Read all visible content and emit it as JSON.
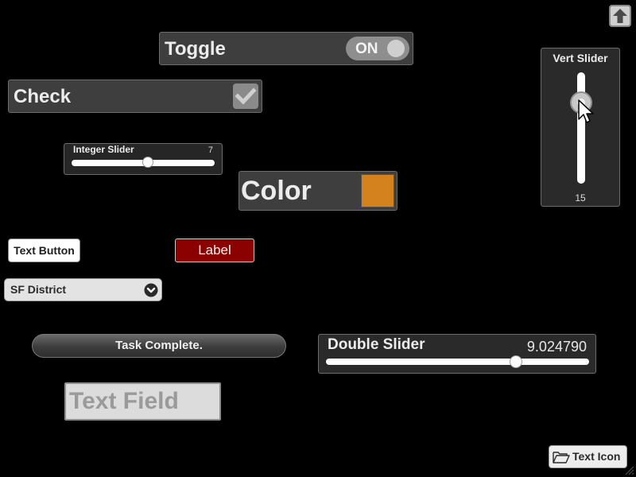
{
  "toggle": {
    "label": "Toggle",
    "state": "ON",
    "on": true
  },
  "check": {
    "label": "Check",
    "checked": true
  },
  "integer_slider": {
    "label": "Integer Slider",
    "value": "7",
    "fraction": 0.54
  },
  "color_picker": {
    "label": "Color",
    "color": "#d4821e"
  },
  "vert_slider": {
    "label": "Vert Slider",
    "value": "15",
    "fraction": 0.75
  },
  "text_button": {
    "label": "Text Button"
  },
  "label_widget": {
    "text": "Label"
  },
  "dropdown": {
    "selected": "SF District"
  },
  "progress": {
    "text": "Task Complete."
  },
  "double_slider": {
    "label": "Double Slider",
    "value": "9.024790",
    "fraction": 0.72
  },
  "text_field": {
    "placeholder": "Text Field",
    "value": ""
  },
  "text_icon_button": {
    "label": "Text Icon",
    "icon": "folder-open-icon"
  },
  "corner_button": {
    "icon": "arrow-up-icon"
  },
  "colors": {
    "background": "#000000",
    "panel": "#3e3e3e",
    "label_bg": "#8b0000",
    "swatch": "#d4821e"
  }
}
